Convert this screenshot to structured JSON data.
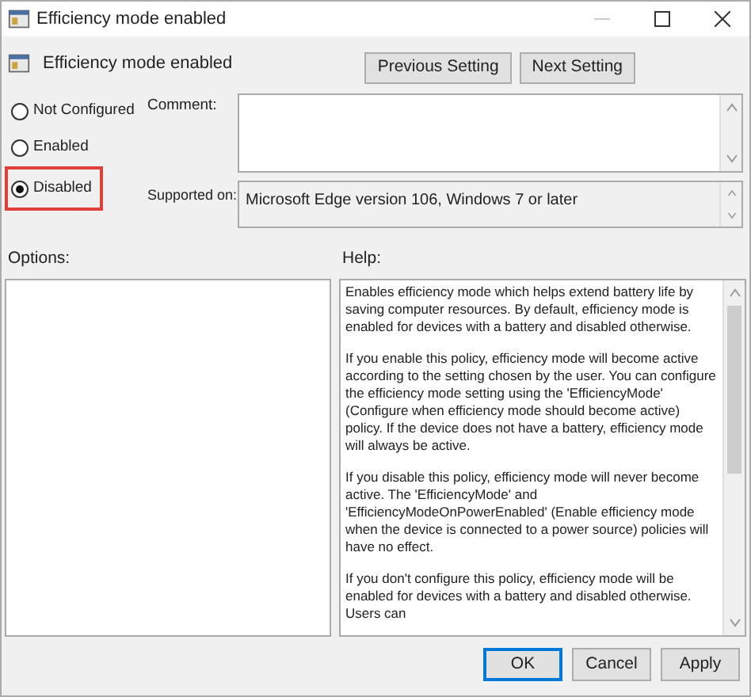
{
  "window": {
    "title": "Efficiency mode enabled"
  },
  "header": {
    "title": "Efficiency mode enabled",
    "buttons": [
      "Previous Setting",
      "Next Setting"
    ]
  },
  "radios": [
    {
      "label": "Not Configured",
      "selected": false,
      "highlighted": false
    },
    {
      "label": "Enabled",
      "selected": false,
      "highlighted": false
    },
    {
      "label": "Disabled",
      "selected": true,
      "highlighted": true
    }
  ],
  "comment": {
    "label": "Comment:"
  },
  "supported_on": {
    "label": "Supported on:",
    "value": "Microsoft Edge version 106, Windows 7 or later"
  },
  "options": {
    "label": "Options:"
  },
  "help": {
    "label": "Help:",
    "paragraphs": [
      "Enables efficiency mode which helps extend battery life by saving computer resources. By default, efficiency mode is enabled for devices with a battery and disabled otherwise.",
      "If you enable this policy, efficiency mode will become active according to the setting chosen by the user. You can configure the efficiency mode setting using the 'EfficiencyMode' (Configure when efficiency mode should become active) policy. If the device does not have a battery, efficiency mode will always be active.",
      "If you disable this policy, efficiency mode will never become active. The 'EfficiencyMode' and 'EfficiencyModeOnPowerEnabled' (Enable efficiency mode when the device is connected to a power source) policies will have no effect.",
      "If you don't configure this policy, efficiency mode will be enabled for devices with a battery and disabled otherwise. Users can"
    ]
  },
  "footer_buttons": [
    {
      "label": "OK",
      "focused": true
    },
    {
      "label": "Cancel",
      "focused": false
    },
    {
      "label": "Apply",
      "focused": false
    }
  ]
}
